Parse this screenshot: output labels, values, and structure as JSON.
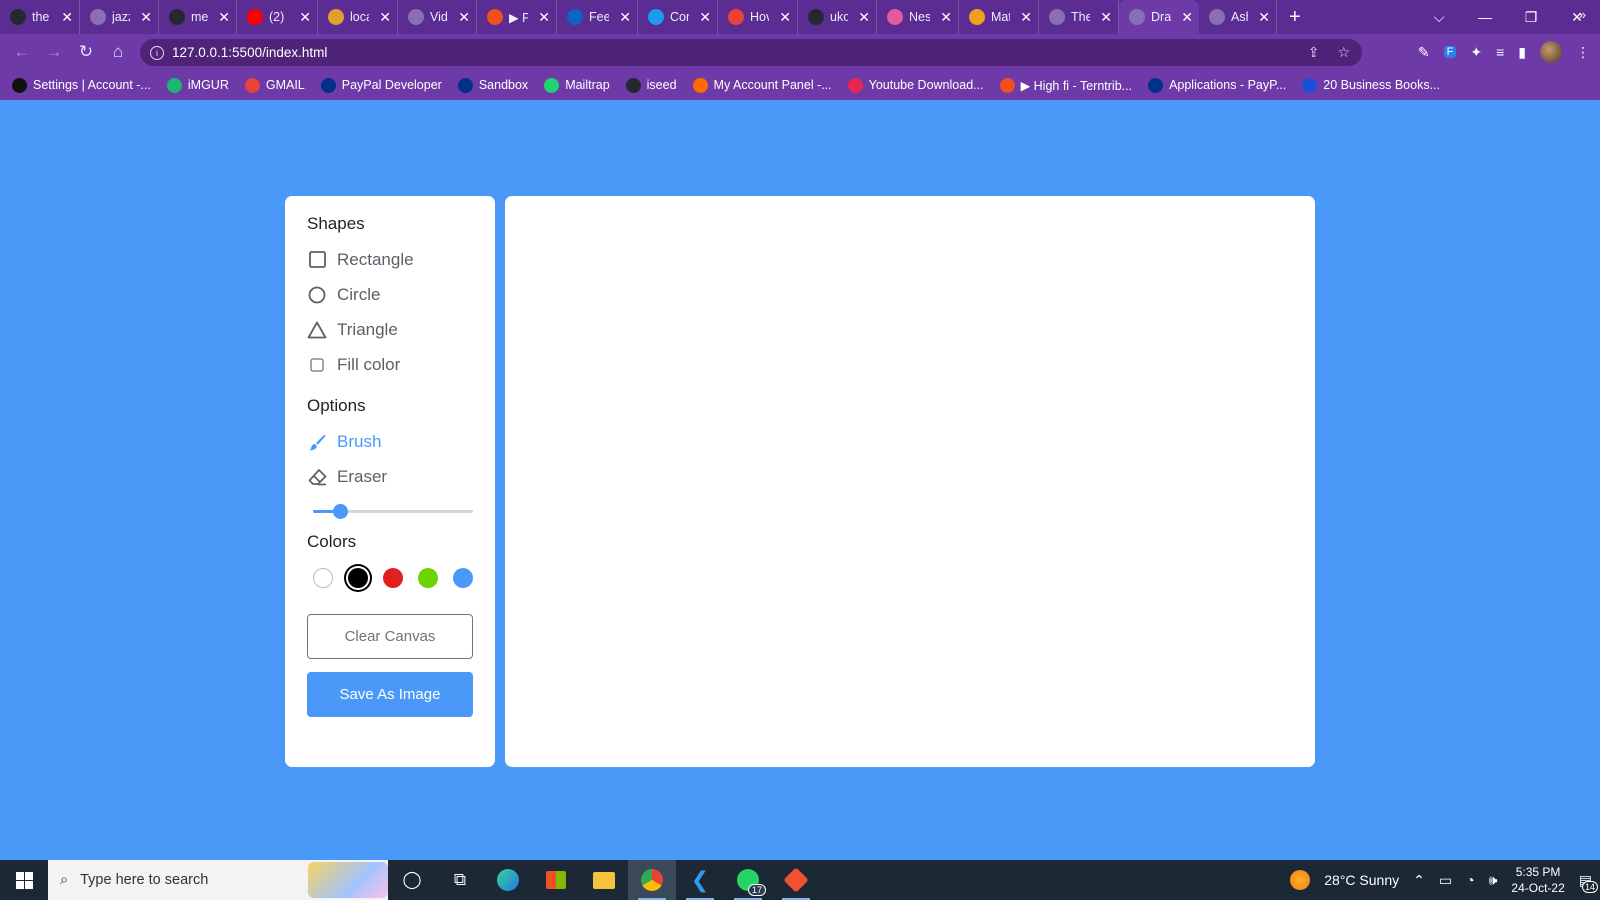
{
  "browser": {
    "tabs": [
      {
        "title": "the",
        "icon": "github-icon",
        "color": "#24292f"
      },
      {
        "title": "jazz",
        "icon": "globe-icon",
        "color": "#8a6fb5"
      },
      {
        "title": "mel",
        "icon": "github-icon",
        "color": "#24292f"
      },
      {
        "title": "(2)",
        "icon": "youtube-icon",
        "color": "#ff0000"
      },
      {
        "title": "loca",
        "icon": "warning-icon",
        "color": "#e0a030"
      },
      {
        "title": "Vid",
        "icon": "globe-icon",
        "color": "#8a6fb5"
      },
      {
        "title": "▶ P",
        "icon": "figma-icon",
        "color": "#f24e1e"
      },
      {
        "title": "Fee",
        "icon": "linkedin-icon",
        "color": "#0a66c2"
      },
      {
        "title": "Cor",
        "icon": "twitter-icon",
        "color": "#1d9bf0"
      },
      {
        "title": "Hov",
        "icon": "gmail-icon",
        "color": "#ea4335"
      },
      {
        "title": "ukor/pa",
        "icon": "github-icon",
        "color": "#24292f"
      },
      {
        "title": "Nesting",
        "icon": "app-icon",
        "color": "#e25b9e"
      },
      {
        "title": "Materia",
        "icon": "app-icon",
        "color": "#f0a020"
      },
      {
        "title": "Themes",
        "icon": "globe-icon",
        "color": "#8a6fb5"
      },
      {
        "title": "Dra",
        "icon": "globe-icon",
        "color": "#8a6fb5",
        "active": true
      },
      {
        "title": "Ashion",
        "icon": "globe-icon",
        "color": "#8a6fb5"
      }
    ],
    "url": "127.0.0.1:5500/index.html",
    "bookmarks": [
      {
        "label": "Settings | Account -...",
        "icon": "account-icon",
        "color": "#111"
      },
      {
        "label": "iMGUR",
        "icon": "imgur-icon",
        "color": "#1bb76e"
      },
      {
        "label": "GMAIL",
        "icon": "gmail-icon",
        "color": "#ea4335"
      },
      {
        "label": "PayPal Developer",
        "icon": "paypal-icon",
        "color": "#003087"
      },
      {
        "label": "Sandbox",
        "icon": "paypal-icon",
        "color": "#003087"
      },
      {
        "label": "Mailtrap",
        "icon": "mailtrap-icon",
        "color": "#22d172"
      },
      {
        "label": "iseed",
        "icon": "github-icon",
        "color": "#24292f"
      },
      {
        "label": "My Account Panel -...",
        "icon": "account-panel-icon",
        "color": "#ff6a00"
      },
      {
        "label": "Youtube Download...",
        "icon": "download-icon",
        "color": "#e8254f"
      },
      {
        "label": "▶ High fi - Terntrib...",
        "icon": "figma-icon",
        "color": "#f24e1e"
      },
      {
        "label": "Applications - PayP...",
        "icon": "paypal-icon",
        "color": "#003087"
      },
      {
        "label": "20 Business Books...",
        "icon": "book-icon",
        "color": "#1d4ed8"
      }
    ]
  },
  "app": {
    "shapes_title": "Shapes",
    "shapes": [
      {
        "label": "Rectangle",
        "icon": "rectangle-icon"
      },
      {
        "label": "Circle",
        "icon": "circle-icon"
      },
      {
        "label": "Triangle",
        "icon": "triangle-icon"
      }
    ],
    "fill_label": "Fill color",
    "fill_checked": false,
    "options_title": "Options",
    "options": [
      {
        "label": "Brush",
        "icon": "brush-icon",
        "active": true
      },
      {
        "label": "Eraser",
        "icon": "eraser-icon",
        "active": false
      }
    ],
    "brush_size_fraction": 0.17,
    "colors_title": "Colors",
    "colors": [
      "#ffffff",
      "#000000",
      "#e02020",
      "#6dd400",
      "#4a98f7"
    ],
    "selected_color_index": 1,
    "clear_label": "Clear Canvas",
    "save_label": "Save As Image",
    "accent": "#4a98f7"
  },
  "taskbar": {
    "search_placeholder": "Type here to search",
    "weather": "28°C  Sunny",
    "time": "5:35 PM",
    "date": "24-Oct-22",
    "whatsapp_badge": "17",
    "notifications": "14"
  }
}
